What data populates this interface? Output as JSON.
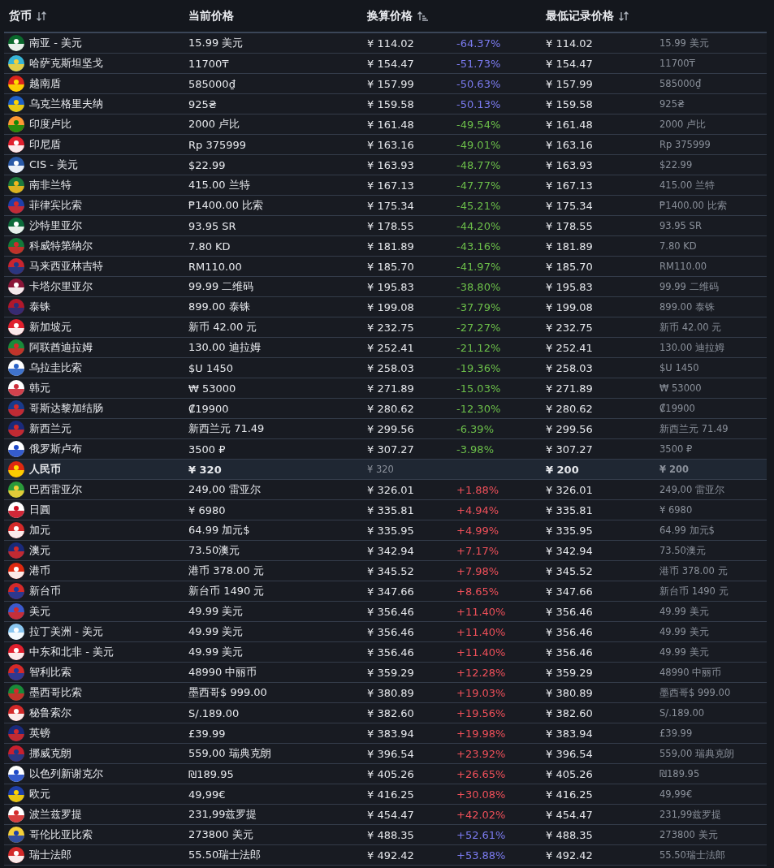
{
  "table": {
    "columns": [
      {
        "label": "货币",
        "sortable": true,
        "sorted": false
      },
      {
        "label": "当前价格",
        "sortable": false
      },
      {
        "label": "换算价格",
        "sortable": true,
        "sorted": true
      },
      {
        "label": "最低记录价格",
        "sortable": true,
        "sorted": false
      }
    ],
    "rows": [
      {
        "currency": "南亚 - 美元",
        "price": "15.99 美元",
        "converted": "¥ 114.02",
        "change": "-64.37%",
        "color": "#7b7bf0",
        "lowest": "¥ 114.02",
        "lowest_local": "15.99 美元",
        "highlighted": false
      },
      {
        "currency": "哈萨克斯坦坚戈",
        "price": "11700₸",
        "converted": "¥ 154.47",
        "change": "-51.73%",
        "color": "#7b7bf0",
        "lowest": "¥ 154.47",
        "lowest_local": "11700₸",
        "highlighted": false
      },
      {
        "currency": "越南盾",
        "price": "585000₫",
        "converted": "¥ 157.99",
        "change": "-50.63%",
        "color": "#7b7bf0",
        "lowest": "¥ 157.99",
        "lowest_local": "585000₫",
        "highlighted": false
      },
      {
        "currency": "乌克兰格里夫纳",
        "price": "925₴",
        "converted": "¥ 159.58",
        "change": "-50.13%",
        "color": "#7b7bf0",
        "lowest": "¥ 159.58",
        "lowest_local": "925₴",
        "highlighted": false
      },
      {
        "currency": "印度卢比",
        "price": "2000 卢比",
        "converted": "¥ 161.48",
        "change": "-49.54%",
        "color": "#6cbf4a",
        "lowest": "¥ 161.48",
        "lowest_local": "2000 卢比",
        "highlighted": false
      },
      {
        "currency": "印尼盾",
        "price": "Rp 375999",
        "converted": "¥ 163.16",
        "change": "-49.01%",
        "color": "#6cbf4a",
        "lowest": "¥ 163.16",
        "lowest_local": "Rp 375999",
        "highlighted": false
      },
      {
        "currency": "CIS - 美元",
        "price": "$22.99",
        "converted": "¥ 163.93",
        "change": "-48.77%",
        "color": "#6cbf4a",
        "lowest": "¥ 163.93",
        "lowest_local": "$22.99",
        "highlighted": false
      },
      {
        "currency": "南非兰特",
        "price": "415.00 兰特",
        "converted": "¥ 167.13",
        "change": "-47.77%",
        "color": "#6cbf4a",
        "lowest": "¥ 167.13",
        "lowest_local": "415.00 兰特",
        "highlighted": false
      },
      {
        "currency": "菲律宾比索",
        "price": "₱1400.00 比索",
        "converted": "¥ 175.34",
        "change": "-45.21%",
        "color": "#6cbf4a",
        "lowest": "¥ 175.34",
        "lowest_local": "₱1400.00 比索",
        "highlighted": false
      },
      {
        "currency": "沙特里亚尔",
        "price": "93.95 SR",
        "converted": "¥ 178.55",
        "change": "-44.20%",
        "color": "#6cbf4a",
        "lowest": "¥ 178.55",
        "lowest_local": "93.95 SR",
        "highlighted": false
      },
      {
        "currency": "科威特第纳尔",
        "price": "7.80 KD",
        "converted": "¥ 181.89",
        "change": "-43.16%",
        "color": "#6cbf4a",
        "lowest": "¥ 181.89",
        "lowest_local": "7.80 KD",
        "highlighted": false
      },
      {
        "currency": "马来西亚林吉特",
        "price": "RM110.00",
        "converted": "¥ 185.70",
        "change": "-41.97%",
        "color": "#6cbf4a",
        "lowest": "¥ 185.70",
        "lowest_local": "RM110.00",
        "highlighted": false
      },
      {
        "currency": "卡塔尔里亚尔",
        "price": "99.99 二维码",
        "converted": "¥ 195.83",
        "change": "-38.80%",
        "color": "#6cbf4a",
        "lowest": "¥ 195.83",
        "lowest_local": "99.99 二维码",
        "highlighted": false
      },
      {
        "currency": "泰铢",
        "price": "899.00 泰铢",
        "converted": "¥ 199.08",
        "change": "-37.79%",
        "color": "#6cbf4a",
        "lowest": "¥ 199.08",
        "lowest_local": "899.00 泰铢",
        "highlighted": false
      },
      {
        "currency": "新加坡元",
        "price": "新币 42.00 元",
        "converted": "¥ 232.75",
        "change": "-27.27%",
        "color": "#6cbf4a",
        "lowest": "¥ 232.75",
        "lowest_local": "新币 42.00 元",
        "highlighted": false
      },
      {
        "currency": "阿联酋迪拉姆",
        "price": "130.00 迪拉姆",
        "converted": "¥ 252.41",
        "change": "-21.12%",
        "color": "#6cbf4a",
        "lowest": "¥ 252.41",
        "lowest_local": "130.00 迪拉姆",
        "highlighted": false
      },
      {
        "currency": "乌拉圭比索",
        "price": "$U 1450",
        "converted": "¥ 258.03",
        "change": "-19.36%",
        "color": "#6cbf4a",
        "lowest": "¥ 258.03",
        "lowest_local": "$U 1450",
        "highlighted": false
      },
      {
        "currency": "韩元",
        "price": "₩ 53000",
        "converted": "¥ 271.89",
        "change": "-15.03%",
        "color": "#6cbf4a",
        "lowest": "¥ 271.89",
        "lowest_local": "₩ 53000",
        "highlighted": false
      },
      {
        "currency": "哥斯达黎加结肠",
        "price": "₡19900",
        "converted": "¥ 280.62",
        "change": "-12.30%",
        "color": "#6cbf4a",
        "lowest": "¥ 280.62",
        "lowest_local": "₡19900",
        "highlighted": false
      },
      {
        "currency": "新西兰元",
        "price": "新西兰元 71.49",
        "converted": "¥ 299.56",
        "change": "-6.39%",
        "color": "#6cbf4a",
        "lowest": "¥ 299.56",
        "lowest_local": "新西兰元 71.49",
        "highlighted": false
      },
      {
        "currency": "俄罗斯卢布",
        "price": "3500 ₽",
        "converted": "¥ 307.27",
        "change": "-3.98%",
        "color": "#6cbf4a",
        "lowest": "¥ 307.27",
        "lowest_local": "3500 ₽",
        "highlighted": false
      },
      {
        "currency": "人民币",
        "price": "¥ 320",
        "converted": "¥ 320",
        "lowest": "¥ 200",
        "lowest_local": "¥ 200",
        "highlighted": true
      },
      {
        "currency": "巴西雷亚尔",
        "price": "249,00 雷亚尔",
        "converted": "¥ 326.01",
        "change": "+1.88%",
        "color": "#f0505a",
        "lowest": "¥ 326.01",
        "lowest_local": "249,00 雷亚尔",
        "highlighted": false
      },
      {
        "currency": "日圓",
        "price": "¥ 6980",
        "converted": "¥ 335.81",
        "change": "+4.94%",
        "color": "#f0505a",
        "lowest": "¥ 335.81",
        "lowest_local": "¥ 6980",
        "highlighted": false
      },
      {
        "currency": "加元",
        "price": "64.99 加元$",
        "converted": "¥ 335.95",
        "change": "+4.99%",
        "color": "#f0505a",
        "lowest": "¥ 335.95",
        "lowest_local": "64.99 加元$",
        "highlighted": false
      },
      {
        "currency": "澳元",
        "price": "73.50澳元",
        "converted": "¥ 342.94",
        "change": "+7.17%",
        "color": "#f0505a",
        "lowest": "¥ 342.94",
        "lowest_local": "73.50澳元",
        "highlighted": false
      },
      {
        "currency": "港币",
        "price": "港币 378.00 元",
        "converted": "¥ 345.52",
        "change": "+7.98%",
        "color": "#f0505a",
        "lowest": "¥ 345.52",
        "lowest_local": "港币 378.00 元",
        "highlighted": false
      },
      {
        "currency": "新台币",
        "price": "新台币 1490 元",
        "converted": "¥ 347.66",
        "change": "+8.65%",
        "color": "#f0505a",
        "lowest": "¥ 347.66",
        "lowest_local": "新台币 1490 元",
        "highlighted": false
      },
      {
        "currency": "美元",
        "price": "49.99 美元",
        "converted": "¥ 356.46",
        "change": "+11.40%",
        "color": "#f0505a",
        "lowest": "¥ 356.46",
        "lowest_local": "49.99 美元",
        "highlighted": false
      },
      {
        "currency": "拉丁美洲 - 美元",
        "price": "49.99 美元",
        "converted": "¥ 356.46",
        "change": "+11.40%",
        "color": "#f0505a",
        "lowest": "¥ 356.46",
        "lowest_local": "49.99 美元",
        "highlighted": false
      },
      {
        "currency": "中东和北非 - 美元",
        "price": "49.99 美元",
        "converted": "¥ 356.46",
        "change": "+11.40%",
        "color": "#f0505a",
        "lowest": "¥ 356.46",
        "lowest_local": "49.99 美元",
        "highlighted": false
      },
      {
        "currency": "智利比索",
        "price": "48990 中丽币",
        "converted": "¥ 359.29",
        "change": "+12.28%",
        "color": "#f0505a",
        "lowest": "¥ 359.29",
        "lowest_local": "48990 中丽币",
        "highlighted": false
      },
      {
        "currency": "墨西哥比索",
        "price": "墨西哥$ 999.00",
        "converted": "¥ 380.89",
        "change": "+19.03%",
        "color": "#f0505a",
        "lowest": "¥ 380.89",
        "lowest_local": "墨西哥$ 999.00",
        "highlighted": false
      },
      {
        "currency": "秘鲁索尔",
        "price": "S/.189.00",
        "converted": "¥ 382.60",
        "change": "+19.56%",
        "color": "#f0505a",
        "lowest": "¥ 382.60",
        "lowest_local": "S/.189.00",
        "highlighted": false
      },
      {
        "currency": "英镑",
        "price": "£39.99",
        "converted": "¥ 383.94",
        "change": "+19.98%",
        "color": "#f0505a",
        "lowest": "¥ 383.94",
        "lowest_local": "£39.99",
        "highlighted": false
      },
      {
        "currency": "挪威克朗",
        "price": "559,00 瑞典克朗",
        "converted": "¥ 396.54",
        "change": "+23.92%",
        "color": "#f0505a",
        "lowest": "¥ 396.54",
        "lowest_local": "559,00 瑞典克朗",
        "highlighted": false
      },
      {
        "currency": "以色列新谢克尔",
        "price": "₪189.95",
        "converted": "¥ 405.26",
        "change": "+26.65%",
        "color": "#f0505a",
        "lowest": "¥ 405.26",
        "lowest_local": "₪189.95",
        "highlighted": false
      },
      {
        "currency": "欧元",
        "price": "49,99€",
        "converted": "¥ 416.25",
        "change": "+30.08%",
        "color": "#f0505a",
        "lowest": "¥ 416.25",
        "lowest_local": "49,99€",
        "highlighted": false
      },
      {
        "currency": "波兰兹罗提",
        "price": "231,99兹罗提",
        "converted": "¥ 454.47",
        "change": "+42.02%",
        "color": "#f0505a",
        "lowest": "¥ 454.47",
        "lowest_local": "231,99兹罗提",
        "highlighted": false
      },
      {
        "currency": "哥伦比亚比索",
        "price": "273800 美元",
        "converted": "¥ 488.35",
        "change": "+52.61%",
        "color": "#7b7bf0",
        "lowest": "¥ 488.35",
        "lowest_local": "273800 美元",
        "highlighted": false
      },
      {
        "currency": "瑞士法郎",
        "price": "55.50瑞士法郎",
        "converted": "¥ 492.42",
        "change": "+53.88%",
        "color": "#7b7bf0",
        "lowest": "¥ 492.42",
        "lowest_local": "55.50瑞士法郎",
        "highlighted": false
      }
    ]
  }
}
